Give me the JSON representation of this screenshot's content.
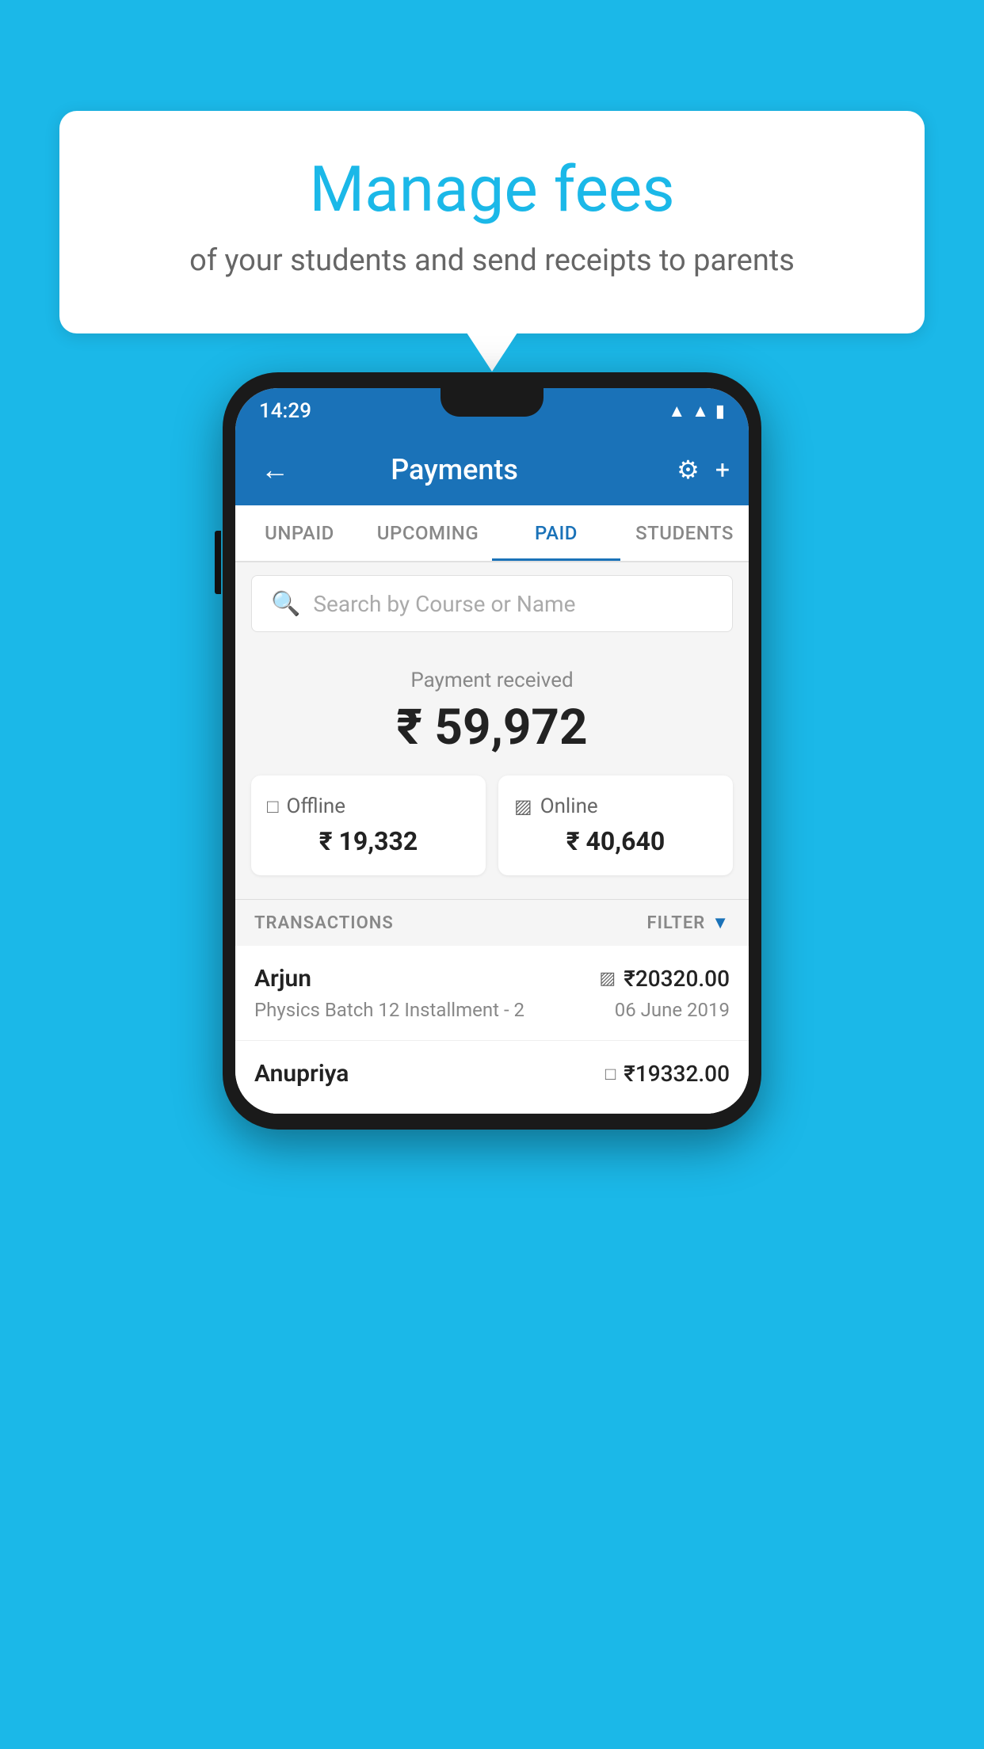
{
  "background_color": "#1bb8e8",
  "speech_bubble": {
    "title": "Manage fees",
    "subtitle": "of your students and send receipts to parents"
  },
  "phone": {
    "status_bar": {
      "time": "14:29",
      "wifi": "▼",
      "signal": "▲",
      "battery": "▮"
    },
    "top_bar": {
      "back_icon": "←",
      "title": "Payments",
      "gear_icon": "⚙",
      "plus_icon": "+"
    },
    "tabs": [
      {
        "label": "UNPAID",
        "active": false
      },
      {
        "label": "UPCOMING",
        "active": false
      },
      {
        "label": "PAID",
        "active": true
      },
      {
        "label": "STUDENTS",
        "active": false
      }
    ],
    "search": {
      "placeholder": "Search by Course or Name",
      "search_icon": "🔍"
    },
    "payment_summary": {
      "label": "Payment received",
      "total": "₹ 59,972",
      "offline": {
        "label": "Offline",
        "amount": "₹ 19,332"
      },
      "online": {
        "label": "Online",
        "amount": "₹ 40,640"
      }
    },
    "transactions_section": {
      "label": "TRANSACTIONS",
      "filter_label": "FILTER"
    },
    "transactions": [
      {
        "name": "Arjun",
        "course": "Physics Batch 12 Installment - 2",
        "amount": "₹20320.00",
        "date": "06 June 2019",
        "payment_type": "card"
      },
      {
        "name": "Anupriya",
        "course": "",
        "amount": "₹19332.00",
        "date": "",
        "payment_type": "cash"
      }
    ]
  }
}
